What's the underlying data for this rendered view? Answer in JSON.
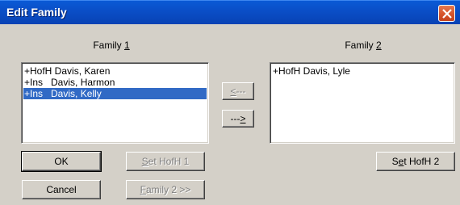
{
  "window": {
    "title": "Edit Family"
  },
  "family1": {
    "label_pre": "Family ",
    "label_accel": "1",
    "items": [
      {
        "text": "+HofH Davis, Karen"
      },
      {
        "text": "+Ins   Davis, Harmon"
      },
      {
        "text": "+Ins   Davis, Kelly",
        "selected": true
      }
    ]
  },
  "family2": {
    "label_pre": "Family ",
    "label_accel": "2",
    "items": [
      {
        "text": "+HofH Davis, Lyle"
      }
    ]
  },
  "move_left": {
    "accel": "<",
    "rest": "---"
  },
  "move_right": {
    "pre": "---",
    "accel": ">"
  },
  "buttons": {
    "ok": "OK",
    "cancel": "Cancel",
    "set_hofh1": {
      "accel": "S",
      "rest": "et HofH 1"
    },
    "family2_nav": {
      "accel": "F",
      "rest": "amily 2 >>"
    },
    "set_hofh2": {
      "pre": "S",
      "accel": "e",
      "rest": "t HofH 2"
    }
  },
  "colors": {
    "titlebar": "#0a4fc8",
    "selection": "#316ac5",
    "close": "#d5522a"
  }
}
